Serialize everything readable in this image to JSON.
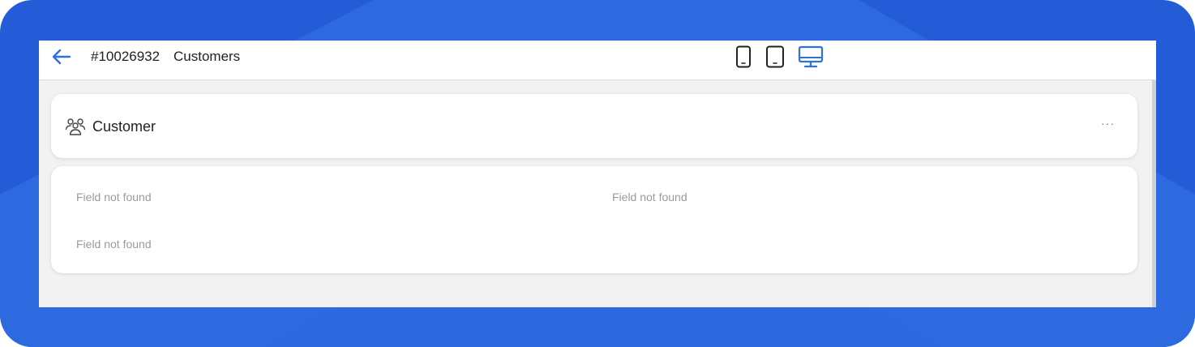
{
  "header": {
    "record_id": "#10026932",
    "title": "Customers"
  },
  "icons": {
    "back": "arrow-left-icon",
    "mobile": "mobile-device-icon",
    "tablet": "tablet-device-icon",
    "desktop": "desktop-monitor-icon",
    "customer": "users-group-icon",
    "more": "more-horizontal-icon"
  },
  "device_selector": {
    "options": [
      "mobile",
      "tablet",
      "desktop"
    ],
    "selected": "desktop"
  },
  "section": {
    "title": "Customer",
    "more_label": "···"
  },
  "fields": [
    "Field not found",
    "Field not found",
    "Field not found"
  ],
  "colors": {
    "background": "#245bd7",
    "accent": "#2f6fe0",
    "icon_dark": "#222222",
    "muted_text": "#9a9a9a"
  }
}
